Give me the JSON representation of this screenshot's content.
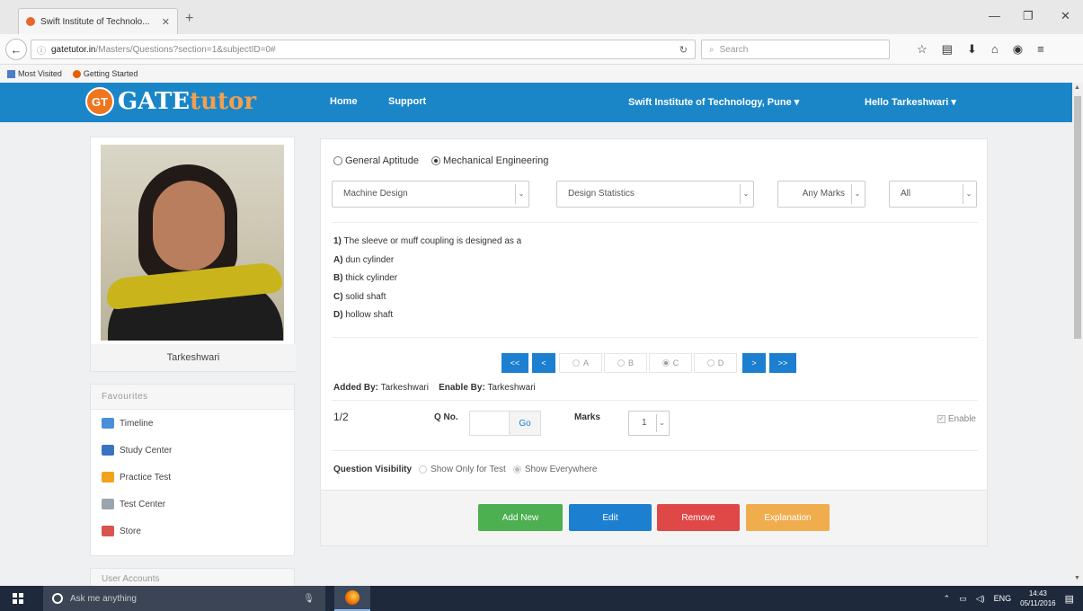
{
  "browser": {
    "tab_title": "Swift Institute of Technolo...",
    "tab_close": "✕",
    "new_tab": "+",
    "url_domain": "gatetutor.in",
    "url_path": "/Masters/Questions?section=1&subjectID=0#",
    "search_placeholder": "Search",
    "bookmarks": [
      "Most Visited",
      "Getting Started"
    ]
  },
  "header": {
    "logo_badge": "GT",
    "logo_gate": "GATE",
    "logo_tutor": "tutor",
    "nav": [
      "Home",
      "Support"
    ],
    "institute": "Swift Institute of Technology, Pune ▾",
    "user": "Hello Tarkeshwari ▾"
  },
  "sidebar": {
    "profile_name": "Tarkeshwari",
    "favourites_title": "Favourites",
    "favourites": [
      {
        "label": "Timeline",
        "icon": "timeline-icon",
        "color": "#4a8fd8"
      },
      {
        "label": "Study Center",
        "icon": "study-center-icon",
        "color": "#3b73c4"
      },
      {
        "label": "Practice Test",
        "icon": "practice-test-icon",
        "color": "#f2a21b"
      },
      {
        "label": "Test Center",
        "icon": "test-center-icon",
        "color": "#9aa4ad"
      },
      {
        "label": "Store",
        "icon": "store-icon",
        "color": "#d9534f"
      }
    ],
    "user_accounts_title": "User Accounts"
  },
  "main": {
    "sections": [
      {
        "label": "General Aptitude",
        "selected": false
      },
      {
        "label": "Mechanical Engineering",
        "selected": true
      }
    ],
    "subject": "Machine Design",
    "topic": "Design Statistics",
    "marks_filter": "Any Marks",
    "type_filter": "All",
    "question": {
      "number": "1)",
      "text": "The sleeve or muff coupling is designed as a",
      "options": [
        {
          "key": "A)",
          "text": "dun cylinder"
        },
        {
          "key": "B)",
          "text": "thick cylinder"
        },
        {
          "key": "C)",
          "text": "solid shaft"
        },
        {
          "key": "D)",
          "text": "hollow shaft"
        }
      ]
    },
    "pager": {
      "first": "<<",
      "prev": "<",
      "next": ">",
      "last": ">>",
      "answers": [
        {
          "label": "A",
          "selected": false
        },
        {
          "label": "B",
          "selected": false
        },
        {
          "label": "C",
          "selected": true
        },
        {
          "label": "D",
          "selected": false
        }
      ]
    },
    "added_by_label": "Added By:",
    "added_by": "Tarkeshwari",
    "enable_by_label": "Enable By:",
    "enable_by": "Tarkeshwari",
    "position": "1/2",
    "qno_label": "Q No.",
    "go_label": "Go",
    "marks_label": "Marks",
    "marks_value": "1",
    "enable_label": "Enable",
    "visibility_label": "Question Visibility",
    "visibility_options": [
      {
        "label": "Show Only for Test",
        "selected": false
      },
      {
        "label": "Show Everywhere",
        "selected": true
      }
    ],
    "actions": [
      {
        "label": "Add New",
        "color": "#4caf50"
      },
      {
        "label": "Edit",
        "color": "#1c7fd0"
      },
      {
        "label": "Remove",
        "color": "#e04848"
      },
      {
        "label": "Explanation",
        "color": "#f0ad4e"
      }
    ]
  },
  "taskbar": {
    "search_placeholder": "Ask me anything",
    "lang": "ENG",
    "time": "14:43",
    "date": "05/11/2016"
  }
}
